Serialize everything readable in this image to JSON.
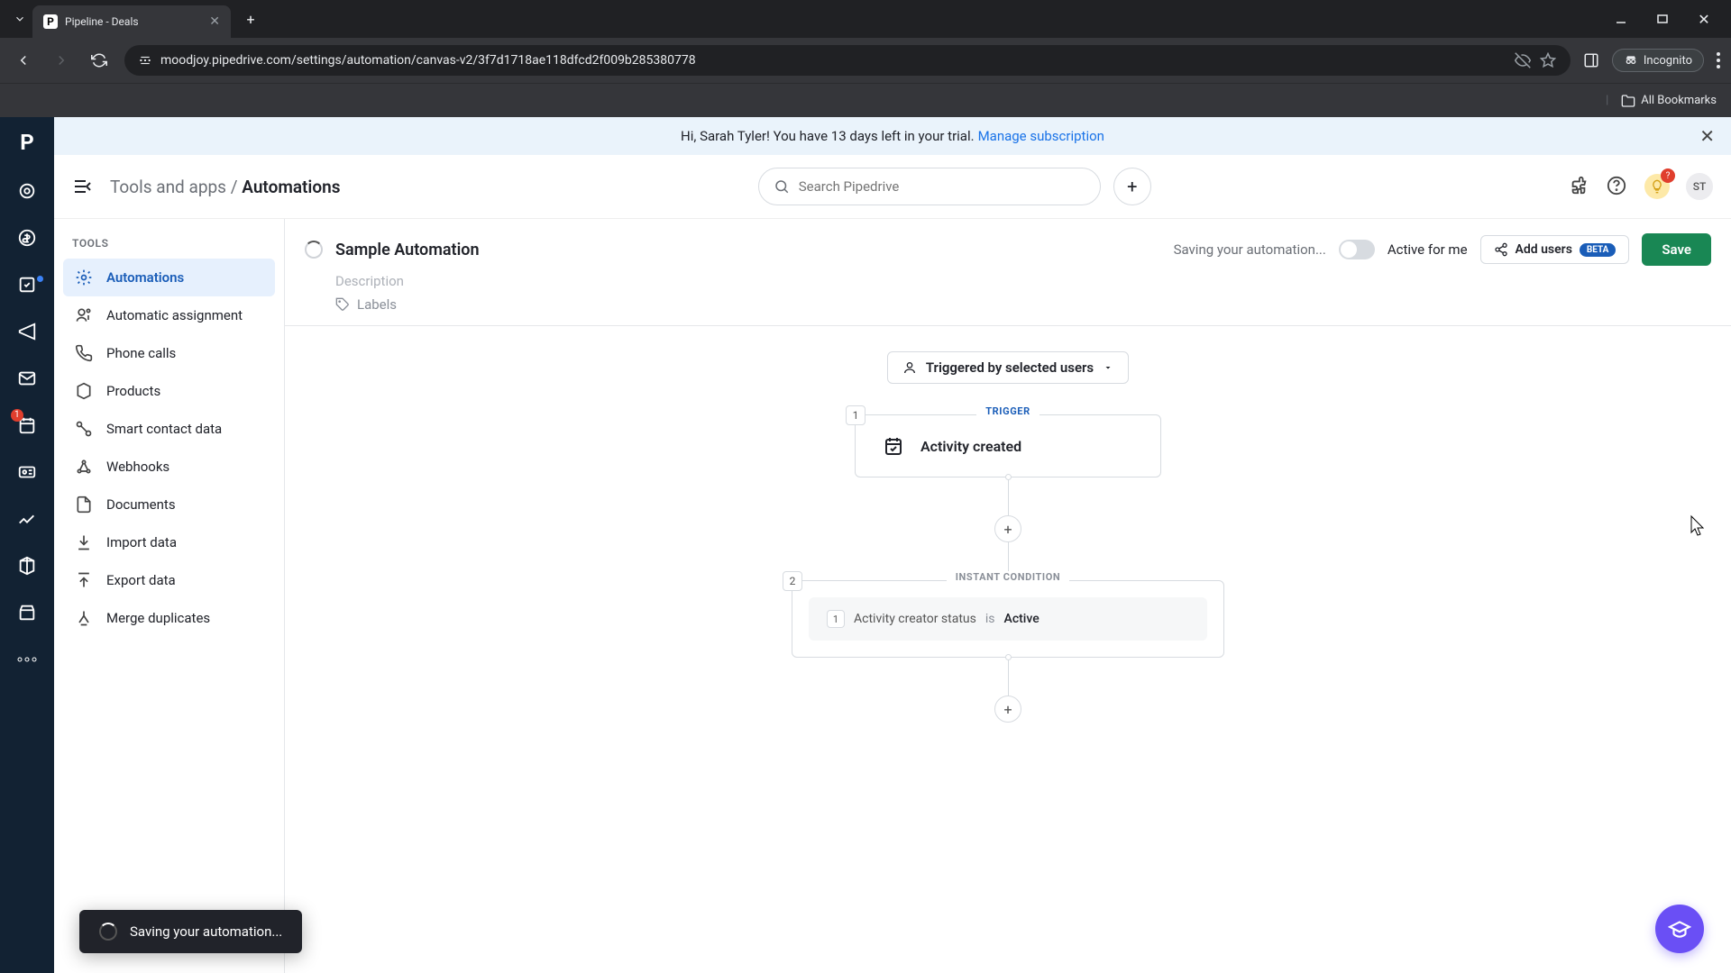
{
  "browser": {
    "tab_title": "Pipeline - Deals",
    "url": "moodjoy.pipedrive.com/settings/automation/canvas-v2/3f7d1718ae118dfcd2f009b285380778",
    "incognito_label": "Incognito",
    "bookmarks_label": "All Bookmarks"
  },
  "promo": {
    "text": "Hi, Sarah Tyler! You have 13 days left in your trial.",
    "link": "Manage subscription"
  },
  "header": {
    "breadcrumb_root": "Tools and apps",
    "breadcrumb_current": "Automations",
    "search_placeholder": "Search Pipedrive",
    "avatar_initials": "ST"
  },
  "leftnav_badge": "1",
  "tools": {
    "heading": "TOOLS",
    "items": [
      "Automations",
      "Automatic assignment",
      "Phone calls",
      "Products",
      "Smart contact data",
      "Webhooks",
      "Documents",
      "Import data",
      "Export data",
      "Merge duplicates"
    ]
  },
  "automation": {
    "title": "Sample Automation",
    "description_placeholder": "Description",
    "labels_label": "Labels",
    "saving_text": "Saving your automation...",
    "active_label": "Active for me",
    "add_users_label": "Add users",
    "beta_label": "BETA",
    "save_label": "Save",
    "trigger_selector": "Triggered by selected users"
  },
  "canvas": {
    "trigger_label": "TRIGGER",
    "trigger_num": "1",
    "trigger_title": "Activity created",
    "condition_label": "INSTANT CONDITION",
    "condition_num": "2",
    "cond_step": "1",
    "cond_field": "Activity creator status",
    "cond_op": "is",
    "cond_value": "Active"
  },
  "toast": {
    "message": "Saving your automation..."
  }
}
